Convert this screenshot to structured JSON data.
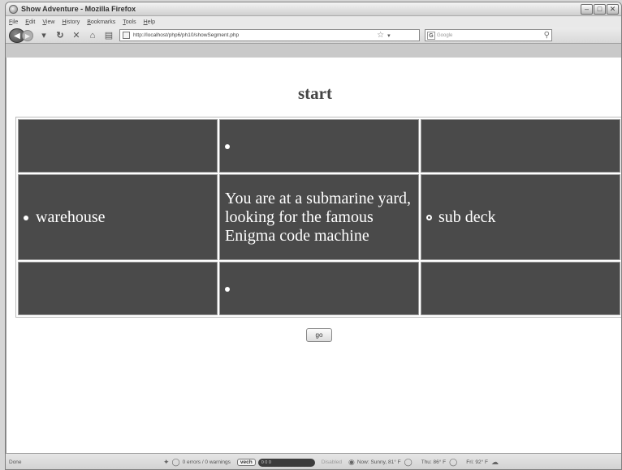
{
  "window": {
    "title": "Show Adventure - Mozilla Firefox",
    "buttons": [
      "–",
      "□",
      "✕"
    ]
  },
  "menu": [
    "File",
    "Edit",
    "View",
    "History",
    "Bookmarks",
    "Tools",
    "Help"
  ],
  "toolbar": {
    "url": "http://localhost/php6/ph10/showSegment.php",
    "search_placeholder": "Google"
  },
  "page": {
    "heading": "start",
    "cells": {
      "north": "",
      "west": "warehouse",
      "description": "You are at a submarine yard, looking for the famous Enigma code machine",
      "east": "sub deck",
      "south": ""
    },
    "go_label": "go"
  },
  "statusbar": {
    "done": "Done",
    "errors": "0 errors / 0 warnings",
    "vech_label": "vech",
    "vech_counts": "0  0  0",
    "disabled": "Disabled",
    "weather_now": "Now: Sunny, 81° F",
    "weather_thu": "Thu: 86° F",
    "weather_fri": "Fri: 92° F"
  }
}
